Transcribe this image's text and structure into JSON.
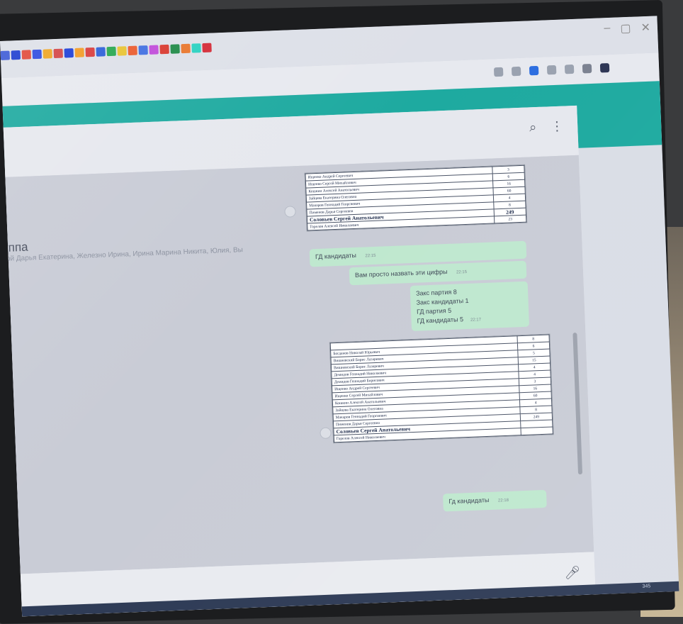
{
  "chat": {
    "title": "уппа",
    "members": "вой Дарья Екатерина, Железно Ирина, Ирина Марина Никита, Юлия, Вы"
  },
  "tab_colors": [
    "#3d5bd6",
    "#1d3ed0",
    "#e14a3a",
    "#2e4be0",
    "#f0a522",
    "#d34545",
    "#1c3dd7",
    "#f29b24",
    "#d83a3a",
    "#2b5ed8",
    "#26a64f",
    "#e8c331",
    "#ea5a2d",
    "#3f6ee1",
    "#c04ad9",
    "#d9382e",
    "#1f8a46",
    "#e9762b",
    "#2ad1c1",
    "#d42a36"
  ],
  "table_a": [
    {
      "name": "Ищенко Андрей Сергеевич",
      "val": "3"
    },
    {
      "name": "Ищенко Сергей Михайлович",
      "val": "6"
    },
    {
      "name": "Кошкин Алексей Анатольевич",
      "val": "16"
    },
    {
      "name": "Зайцева Екатерина Олеговна",
      "val": "60"
    },
    {
      "name": "Макаров Геннадий Георгиевич",
      "val": "4"
    },
    {
      "name": "Пименов Дарья Сергеевна",
      "val": "8"
    },
    {
      "name": "Соловьев Сергей Анатольевич",
      "val": "249",
      "bold": true
    },
    {
      "name": "Горелов Алексей Николаевич",
      "val": "23"
    }
  ],
  "table_b": [
    {
      "name": "",
      "val": "8"
    },
    {
      "name": "Богданов Николай Юрьевич",
      "val": "6"
    },
    {
      "name": "Вишневский Борис Лазаревич",
      "val": "5"
    },
    {
      "name": "Вишневский Борис Лазаревич",
      "val": "15"
    },
    {
      "name": "Демидов Геннадий Николаевич",
      "val": "4"
    },
    {
      "name": "Демидов Геннадий Борисович",
      "val": "4"
    },
    {
      "name": "Ищенко Андрей Сергеевич",
      "val": "3"
    },
    {
      "name": "Ищенко Сергей Михайлович",
      "val": "16"
    },
    {
      "name": "Кошкин Алексей Анатольевич",
      "val": "60"
    },
    {
      "name": "Зайцева Екатерина Олеговна",
      "val": "4"
    },
    {
      "name": "Макаров Геннадий Георгиевич",
      "val": "8"
    },
    {
      "name": "Пименов Дарья Сергеевна",
      "val": "249"
    },
    {
      "name": "Соловьев Сергей Анатольевич",
      "val": "",
      "bold": true
    },
    {
      "name": "Горелов Алексей Николаевич",
      "val": ""
    }
  ],
  "messages": {
    "m1": "ГД кандидаты",
    "m1_time": "22:15",
    "m2": "Вам просто назвать эти цифры",
    "m2_time": "22:15",
    "m3_lines": [
      "Закс партия 8",
      "Закс кандидаты 1",
      "ГД партия 5",
      "ГД кандидаты 5"
    ],
    "m3_time": "22:17",
    "m4": "Гд кандидаты",
    "m4_time": "22:18"
  },
  "tray": {
    "clock": "345"
  }
}
